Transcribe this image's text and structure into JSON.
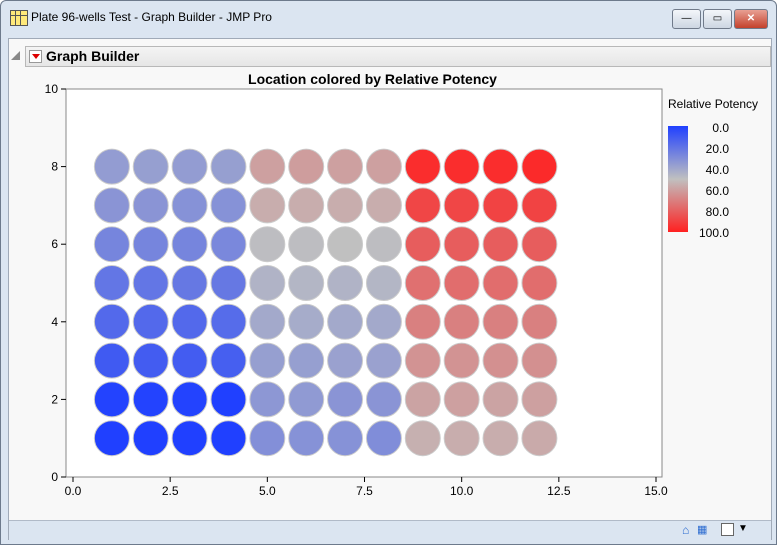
{
  "window": {
    "title": "Plate 96-wells Test - Graph Builder - JMP Pro",
    "minimize": "—",
    "maximize": "▭",
    "close": "✕"
  },
  "outline": {
    "title": "Graph Builder"
  },
  "chart_data": {
    "type": "scatter",
    "title": "Location colored by Relative Potency",
    "xlim": [
      0,
      15
    ],
    "ylim": [
      0,
      10
    ],
    "xticks": [
      "0.0",
      "2.5",
      "5.0",
      "7.5",
      "10.0",
      "12.5",
      "15.0"
    ],
    "yticks": [
      "0",
      "2",
      "4",
      "6",
      "8",
      "10"
    ],
    "color_legend": {
      "title": "Relative Potency",
      "labels": [
        "0.0",
        "20.0",
        "40.0",
        "60.0",
        "80.0",
        "100.0"
      ],
      "colors": [
        "#2040ff",
        "#c0c0c0",
        "#ff2020"
      ]
    },
    "x": [
      1,
      2,
      3,
      4,
      5,
      6,
      7,
      8,
      9,
      10,
      11,
      12
    ],
    "y": [
      1,
      2,
      3,
      4,
      5,
      6,
      7,
      8
    ],
    "potency_by_row": [
      [
        0,
        0,
        0,
        0,
        31,
        32,
        32,
        30,
        55,
        56,
        56,
        57
      ],
      [
        1,
        1,
        1,
        0,
        34,
        35,
        33,
        33,
        59,
        60,
        59,
        60
      ],
      [
        10,
        11,
        11,
        12,
        37,
        37,
        38,
        38,
        64,
        64,
        65,
        65
      ],
      [
        16,
        16,
        16,
        17,
        41,
        42,
        41,
        41,
        70,
        70,
        70,
        70
      ],
      [
        21,
        21,
        22,
        22,
        45,
        46,
        45,
        46,
        75,
        76,
        76,
        76
      ],
      [
        27,
        27,
        27,
        28,
        49,
        49,
        50,
        49,
        81,
        81,
        81,
        81
      ],
      [
        33,
        33,
        32,
        32,
        56,
        56,
        56,
        56,
        88,
        88,
        89,
        89
      ],
      [
        36,
        37,
        36,
        37,
        60,
        61,
        60,
        60,
        96,
        96,
        96,
        97
      ]
    ]
  }
}
